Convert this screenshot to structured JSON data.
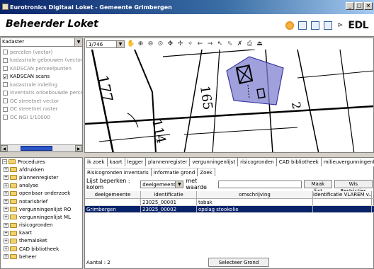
{
  "window": {
    "title": "Eurotronics Digitaal Loket - Gemeente Grimbergen",
    "buttons": [
      "_",
      "□",
      "×"
    ]
  },
  "header": {
    "title": "Beheerder Loket",
    "logo": "EDL"
  },
  "layers": {
    "selected_category": "Kadaster",
    "items": [
      {
        "label": "percelen (vector)",
        "checked": false
      },
      {
        "label": "kadastrale gebouwen (vector",
        "checked": false
      },
      {
        "label": "KADSCAN perceelpunten",
        "checked": false
      },
      {
        "label": "KADSCAN scans",
        "checked": true
      },
      {
        "label": "kadastrale indeling",
        "checked": false
      },
      {
        "label": "inventaris onbebouwde perce",
        "checked": false
      },
      {
        "label": "OC streetnet vector",
        "checked": false
      },
      {
        "label": "OC streetnet raster",
        "checked": false
      },
      {
        "label": "OC NGI 1/10000",
        "checked": false
      }
    ]
  },
  "map": {
    "scale": "1/746",
    "polygon_fill": "#8080d0",
    "labels": [
      "177",
      "165",
      "114",
      "2"
    ]
  },
  "procedures": {
    "root": "Procedures",
    "items": [
      "afdrukken",
      "plannenregister",
      "analyse",
      "openbaar onderzoek",
      "notarisbrief",
      "vergunningenlijst RO",
      "vergunningenlijst ML",
      "risicogronden",
      "kaart",
      "themaloket",
      "CAD bibliotheek",
      "beheer"
    ]
  },
  "tabs": [
    "ik zoek",
    "kaart",
    "legger",
    "plannenregister",
    "vergunningenlijst",
    "risicogronden",
    "CAD bibliotheek",
    "milieuvergunningenlijst"
  ],
  "subtabs": [
    "Risicogronden inventaris",
    "Informatie grond",
    "Zoek"
  ],
  "filter": {
    "label_prefix": "Lijst beperken : kolom",
    "column": "deelgemeente",
    "label_mid": "met waarde",
    "value": "",
    "btn_make": "Maak lijst",
    "btn_clear": "Wis Restricties"
  },
  "table": {
    "columns": [
      "deelgemeente",
      "identificatie",
      "omschrijving",
      "identificatie VLAREM v..."
    ],
    "rows": [
      {
        "deelgemeente": "",
        "identificatie": "23025_00001",
        "omschrijving": "tabak",
        "vlarem": ""
      },
      {
        "deelgemeente": "Grimbergen",
        "identificatie": "23025_00002",
        "omschrijving": "opslag stookolie",
        "vlarem": ""
      }
    ]
  },
  "footer": {
    "count": "Aantal : 2",
    "select_button": "Selecteer Grond"
  }
}
